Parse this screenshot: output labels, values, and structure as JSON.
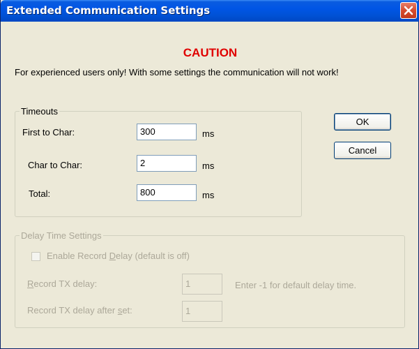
{
  "window": {
    "title": "Extended Communication Settings"
  },
  "caution": "CAUTION",
  "warning": "For experienced users only! With some settings the communication will not work!",
  "timeouts": {
    "legend": "Timeouts",
    "first_to_char": {
      "label": "First to Char:",
      "value": "300",
      "unit": "ms"
    },
    "char_to_char": {
      "label": "Char to Char:",
      "value": "2",
      "unit": "ms"
    },
    "total": {
      "label": "Total:",
      "value": "800",
      "unit": "ms"
    }
  },
  "buttons": {
    "ok": "OK",
    "cancel": "Cancel"
  },
  "delay": {
    "legend": "Delay Time Settings",
    "enable_checkbox": {
      "label": "Enable Record Delay (default is off)",
      "checked": false
    },
    "record_tx_delay": {
      "label": "Record TX delay:",
      "value": "1"
    },
    "hint": "Enter -1 for default delay time.",
    "record_tx_delay_after_set": {
      "label": "Record TX delay after set:",
      "value": "1"
    }
  },
  "colors": {
    "caution": "#e00000",
    "titlebar": "#0055e5",
    "close": "#d64b2e"
  },
  "icons": {
    "close": "close-icon"
  }
}
